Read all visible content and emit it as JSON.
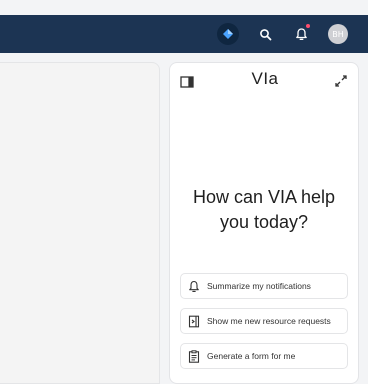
{
  "header": {
    "avatar_initials": "BH",
    "colors": {
      "background": "#1c3453",
      "notification_dot": "#ff4d6d"
    }
  },
  "via_panel": {
    "brand": "VIa",
    "greeting": "How can VIA help you today?",
    "suggestions": [
      {
        "icon": "bell-icon",
        "label": "Summarize my notifications"
      },
      {
        "icon": "doc-arrow-icon",
        "label": "Show me new resource requests"
      },
      {
        "icon": "clipboard-icon",
        "label": "Generate a form for me"
      }
    ]
  }
}
